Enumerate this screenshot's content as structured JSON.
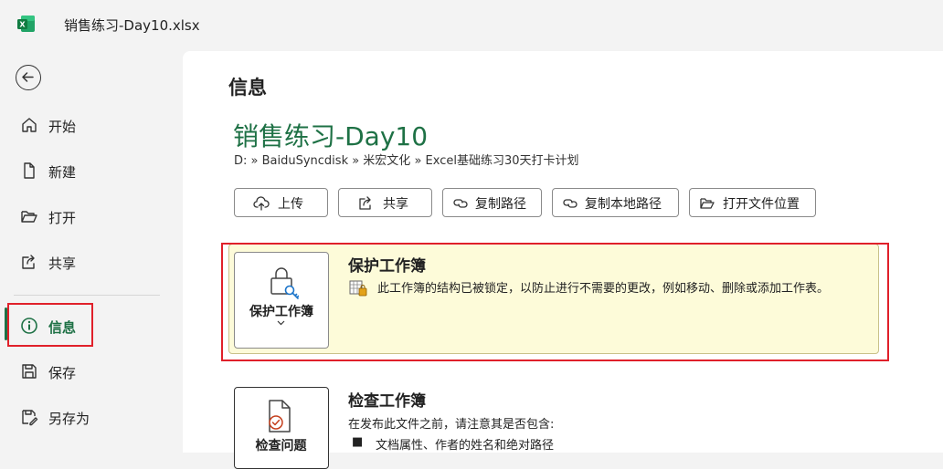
{
  "window": {
    "title": "销售练习-Day10.xlsx"
  },
  "nav": {
    "items": [
      {
        "label": "开始"
      },
      {
        "label": "新建"
      },
      {
        "label": "打开"
      },
      {
        "label": "共享"
      },
      {
        "label": "信息"
      },
      {
        "label": "保存"
      },
      {
        "label": "另存为"
      }
    ],
    "active": "信息"
  },
  "info": {
    "page_title": "信息",
    "doc_title": "销售练习-Day10",
    "path": "D: » BaiduSyncdisk » 米宏文化 » Excel基础练习30天打卡计划",
    "actions": [
      {
        "label": "上传"
      },
      {
        "label": "共享"
      },
      {
        "label": "复制路径"
      },
      {
        "label": "复制本地路径"
      },
      {
        "label": "打开文件位置"
      }
    ],
    "protect": {
      "button_label": "保护工作簿",
      "heading": "保护工作簿",
      "description": "此工作簿的结构已被锁定，以防止进行不需要的更改，例如移动、删除或添加工作表。"
    },
    "inspect": {
      "button_label": "检查问题",
      "heading": "检查工作簿",
      "description": "在发布此文件之前，请注意其是否包含:",
      "bullet": "文档属性、作者的姓名和绝对路径"
    }
  },
  "colors": {
    "accent": "#1e7145",
    "highlight": "#e0202a",
    "warning_bg": "#fdfbd9"
  }
}
